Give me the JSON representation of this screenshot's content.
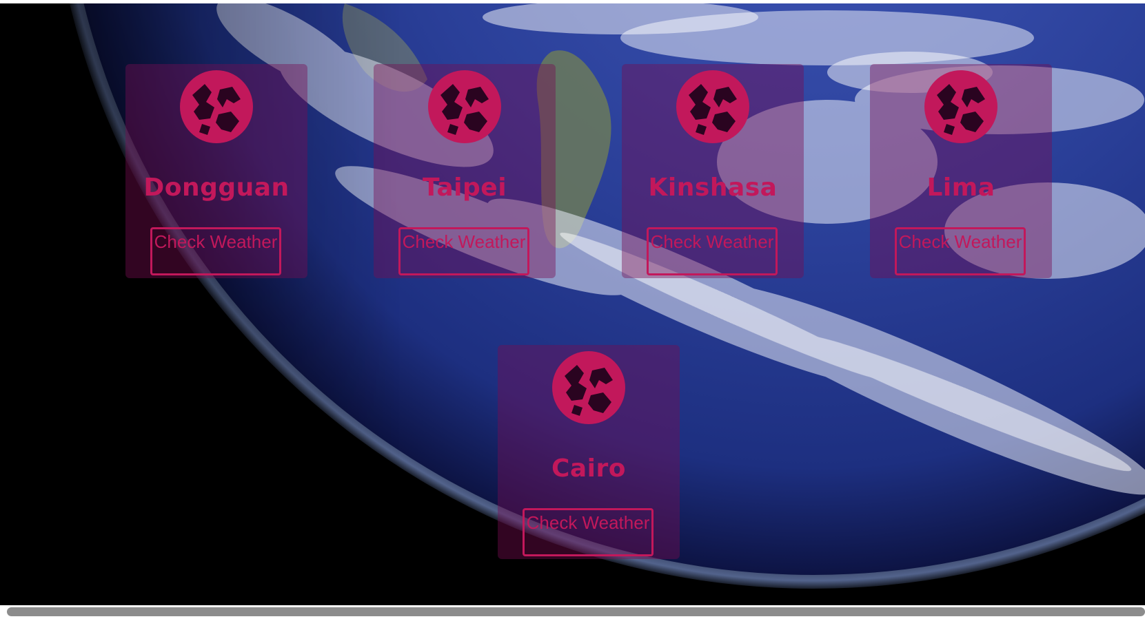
{
  "colors": {
    "accent": "#c2185b",
    "card_background": "rgba(120,12,80,0.42)",
    "page_background": "#000000",
    "scrollbar_thumb": "#8c8c8c"
  },
  "icons": {
    "city_icon": "globe-icon"
  },
  "cards": [
    {
      "city": "Dongguan",
      "button_label": "Check Weather"
    },
    {
      "city": "Taipei",
      "button_label": "Check Weather"
    },
    {
      "city": "Kinshasa",
      "button_label": "Check Weather"
    },
    {
      "city": "Lima",
      "button_label": "Check Weather"
    },
    {
      "city": "Cairo",
      "button_label": "Check Weather"
    }
  ]
}
